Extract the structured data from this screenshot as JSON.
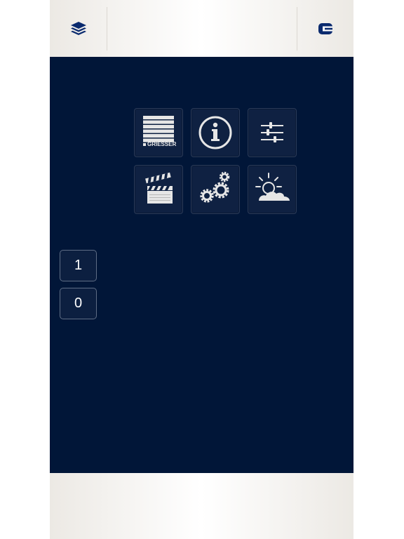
{
  "colors": {
    "background": "#011638",
    "accent": "#0a2a6e",
    "tile_border": "#2a3a58",
    "icon": "#e6e6e6"
  },
  "topbar": {
    "left_icon": "layers-icon",
    "right_icon": "exit-icon"
  },
  "tiles": [
    {
      "icon": "blinds-icon",
      "label": "GRIESSER"
    },
    {
      "icon": "info-icon",
      "label": ""
    },
    {
      "icon": "sliders-icon",
      "label": ""
    },
    {
      "icon": "clapperboard-icon",
      "label": ""
    },
    {
      "icon": "gears-icon",
      "label": ""
    },
    {
      "icon": "weather-icon",
      "label": ""
    }
  ],
  "side_buttons": [
    {
      "label": "1"
    },
    {
      "label": "0"
    }
  ]
}
